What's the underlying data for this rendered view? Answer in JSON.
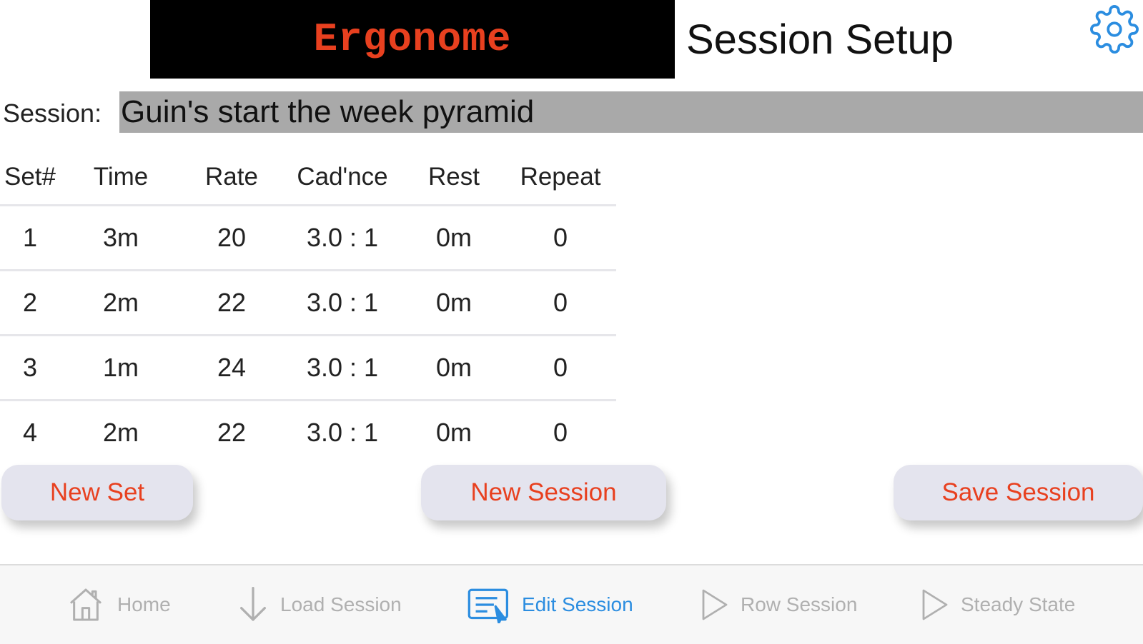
{
  "header": {
    "app_name": "Ergonome",
    "page_title": "Session Setup",
    "settings_icon": "gear-icon"
  },
  "session": {
    "label": "Session:",
    "name": "Guin's start the week pyramid"
  },
  "table": {
    "headers": [
      "Set#",
      "Time",
      "Rate",
      "Cad'nce",
      "Rest",
      "Repeat"
    ],
    "rows": [
      [
        "1",
        "3m",
        "20",
        "3.0 : 1",
        "0m",
        "0"
      ],
      [
        "2",
        "2m",
        "22",
        "3.0 : 1",
        "0m",
        "0"
      ],
      [
        "3",
        "1m",
        "24",
        "3.0 : 1",
        "0m",
        "0"
      ],
      [
        "4",
        "2m",
        "22",
        "3.0 : 1",
        "0m",
        "0"
      ]
    ]
  },
  "buttons": {
    "new_set": "New Set",
    "new_session": "New Session",
    "save_session": "Save Session"
  },
  "tabbar": {
    "active": "Edit Session",
    "items": [
      {
        "label": "Home",
        "icon": "home-icon"
      },
      {
        "label": "Load Session",
        "icon": "down-arrow-icon"
      },
      {
        "label": "Edit Session",
        "icon": "edit-document-icon"
      },
      {
        "label": "Row Session",
        "icon": "play-icon"
      },
      {
        "label": "Steady State",
        "icon": "play-icon"
      }
    ]
  },
  "colors": {
    "accent_red": "#e8401f",
    "active_blue": "#2b8de0",
    "inactive_gray": "#b0b0b0"
  }
}
